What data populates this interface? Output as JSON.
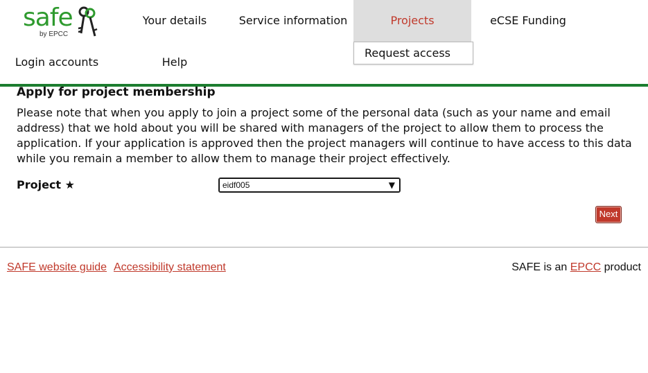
{
  "logo": {
    "word": "safe",
    "sub": "by EPCC"
  },
  "nav": {
    "your_details": "Your details",
    "service_information": "Service information",
    "projects": "Projects",
    "ecse_funding": "eCSE Funding",
    "login_accounts": "Login accounts",
    "help": "Help",
    "dropdown": {
      "request_access": "Request access"
    }
  },
  "colors": {
    "brand_green": "#1c7d2f",
    "accent_red": "#c0392b",
    "active_tab_bg": "#dedede"
  },
  "main": {
    "title": "Apply for project membership",
    "intro": "Please note that when you apply to join a project some of the personal data (such as your name and email address) that we hold about you will be shared with managers of the project to allow them to process the application. If your application is approved then the project managers will continue to have access to this data while you remain a member to allow them to manage their project effectively.",
    "project_label": "Project ★",
    "project_value": "eidf005",
    "next_label": "Next"
  },
  "footer": {
    "guide_link": "SAFE website guide",
    "accessibility_link": "Accessibility statement",
    "product_prefix": "SAFE is an",
    "epcc_link": "EPCC",
    "product_suffix": "product"
  },
  "icons": [
    "keys-icon",
    "dropdown-caret-icon"
  ]
}
